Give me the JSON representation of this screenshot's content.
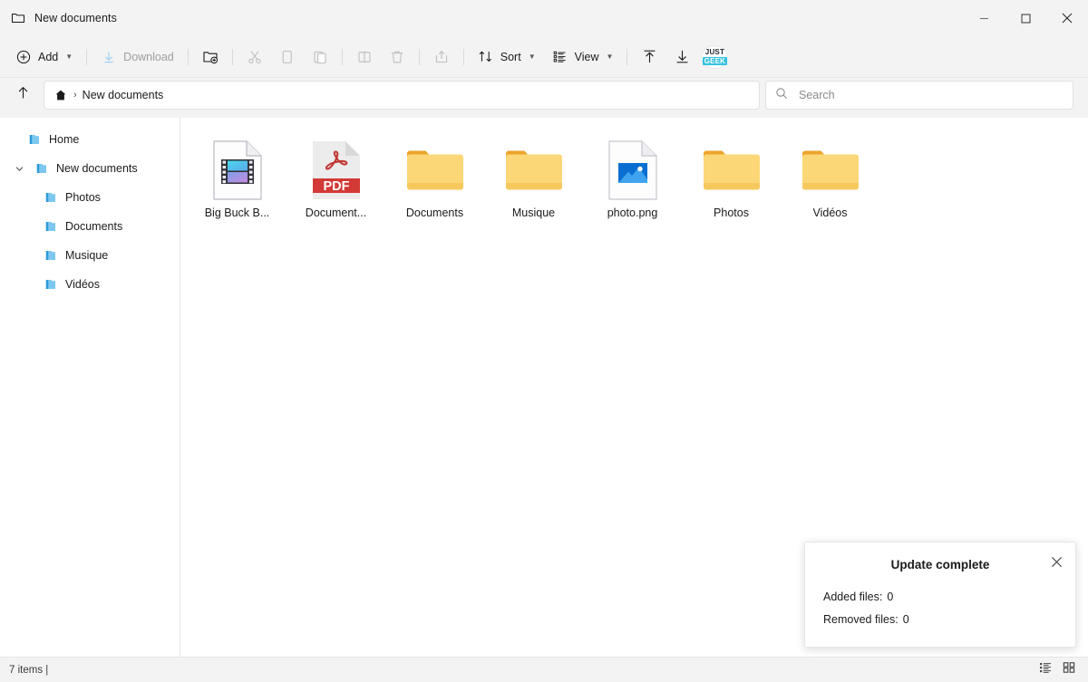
{
  "window": {
    "title": "New documents",
    "title_icon": "folder-icon",
    "controls": {
      "minimize": "Minimize",
      "maximize": "Maximize",
      "close": "Close"
    }
  },
  "toolbar": {
    "add_label": "Add",
    "add_icon": "plus-circle-icon",
    "download_label": "Download",
    "download_icon": "download-arrow-icon",
    "newfolder_icon": "new-folder-icon",
    "cut_icon": "scissors-icon",
    "copy_icon": "copy-icon",
    "paste_icon": "paste-icon",
    "rename_icon": "rename-icon",
    "delete_icon": "trash-icon",
    "share_icon": "share-icon",
    "sort_label": "Sort",
    "sort_icon": "sort-arrows-icon",
    "view_label": "View",
    "view_icon": "view-list-icon",
    "upload_icon": "upload-arrow-icon",
    "sync_down_icon": "download-to-line-icon",
    "logo_top": "JUST",
    "logo_bottom": "GEEK"
  },
  "address": {
    "up_icon": "arrow-up-icon",
    "home_icon": "home-icon",
    "separator": "›",
    "current": "New documents"
  },
  "search": {
    "placeholder": "Search",
    "value": "",
    "icon": "search-icon"
  },
  "sidebar": {
    "items": [
      {
        "label": "Home",
        "icon": "folder-blue-icon",
        "depth": 0,
        "twisty": ""
      },
      {
        "label": "New documents",
        "icon": "folder-blue-icon",
        "depth": 0,
        "twisty": "expanded"
      },
      {
        "label": "Photos",
        "icon": "folder-blue-icon",
        "depth": 1,
        "twisty": ""
      },
      {
        "label": "Documents",
        "icon": "folder-blue-icon",
        "depth": 1,
        "twisty": ""
      },
      {
        "label": "Musique",
        "icon": "folder-blue-icon",
        "depth": 1,
        "twisty": ""
      },
      {
        "label": "Vidéos",
        "icon": "folder-blue-icon",
        "depth": 1,
        "twisty": ""
      }
    ]
  },
  "files": [
    {
      "label": "Big Buck B...",
      "type": "video",
      "icon": "video-file-icon"
    },
    {
      "label": "Document...",
      "type": "pdf",
      "icon": "pdf-file-icon"
    },
    {
      "label": "Documents",
      "type": "folder",
      "icon": "folder-yellow-icon"
    },
    {
      "label": "Musique",
      "type": "folder",
      "icon": "folder-yellow-icon"
    },
    {
      "label": "photo.png",
      "type": "image",
      "icon": "image-file-icon"
    },
    {
      "label": "Photos",
      "type": "folder",
      "icon": "folder-yellow-icon"
    },
    {
      "label": "Vidéos",
      "type": "folder",
      "icon": "folder-yellow-icon"
    }
  ],
  "status": {
    "items_text": "7 items |",
    "view_details_icon": "view-details-icon",
    "view_tiles_icon": "view-tiles-icon"
  },
  "toast": {
    "title": "Update complete",
    "close_icon": "close-icon",
    "added_label": "Added files:",
    "added_value": "0",
    "removed_label": "Removed files:",
    "removed_value": "0"
  },
  "colors": {
    "chrome": "#f3f3f3",
    "accent_blue": "#0078d4",
    "folder_yellow": "#f6c440",
    "pdf_red": "#d33a36",
    "logo_cyan": "#35c3dd"
  }
}
